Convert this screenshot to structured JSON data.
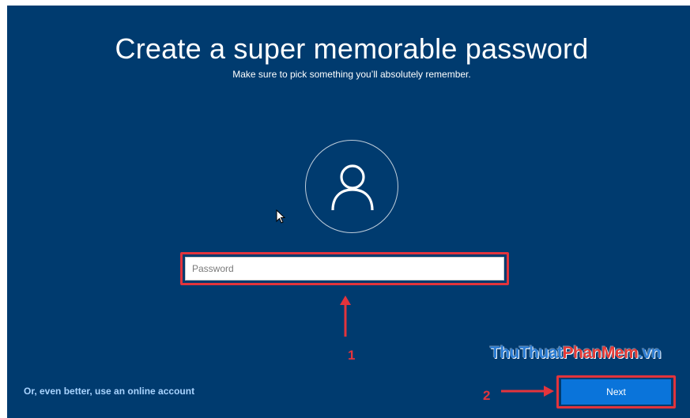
{
  "screen": {
    "title": "Create a super memorable password",
    "subtitle": "Make sure to pick something you’ll absolutely remember.",
    "background_color": "#003b6f"
  },
  "avatar": {
    "icon": "user-icon"
  },
  "password_field": {
    "placeholder": "Password",
    "value": ""
  },
  "footer": {
    "online_account_link": "Or, even better, use an online account",
    "next_label": "Next",
    "next_color": "#0a74da"
  },
  "annotations": {
    "label_1": "1",
    "label_2": "2",
    "color": "#e3343c"
  },
  "watermark": {
    "part1": "ThuThuat",
    "part2": "PhanMem",
    "part3": ".vn"
  }
}
